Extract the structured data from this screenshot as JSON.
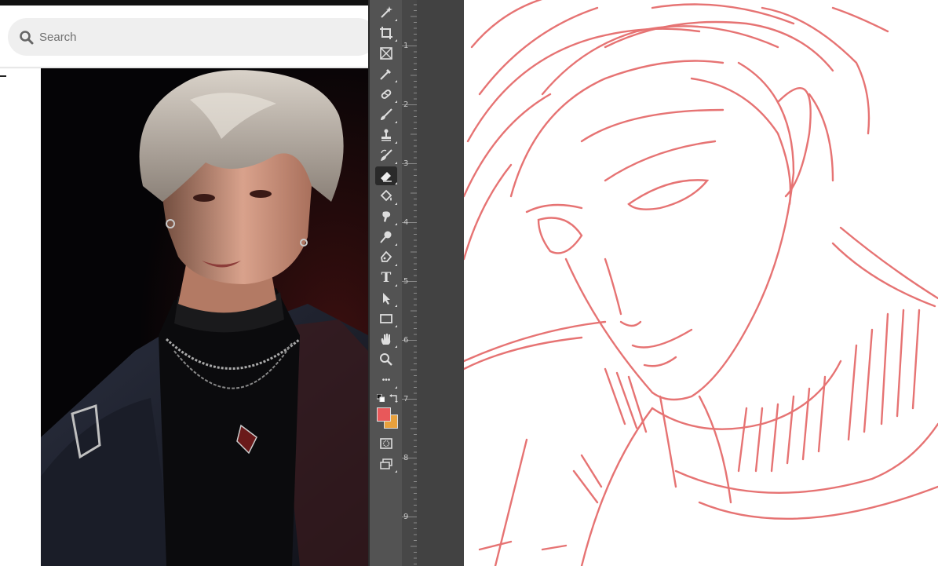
{
  "search": {
    "placeholder": "Search"
  },
  "reference_image": {
    "subject": "portrait-photo",
    "alt": ""
  },
  "toolbar": {
    "tools": [
      "magic-wand-icon",
      "crop-icon",
      "frame-icon",
      "eyedropper-icon",
      "healing-brush-icon",
      "brush-icon",
      "clone-stamp-icon",
      "history-brush-icon",
      "eraser-icon",
      "paint-bucket-icon",
      "smudge-icon",
      "dodge-icon",
      "pen-icon",
      "type-icon",
      "path-selection-icon",
      "rectangle-icon",
      "hand-icon",
      "zoom-icon",
      "more-tools-icon"
    ],
    "active_tool": "eraser-icon",
    "type_glyph": "T",
    "more_glyph": "•••",
    "foreground_color": "#e8585a",
    "background_color": "#e9a13c"
  },
  "ruler": {
    "labels": [
      "1",
      "2",
      "3",
      "4",
      "5",
      "6",
      "7",
      "8",
      "9"
    ]
  },
  "canvas": {
    "stroke_color": "#e25b5b",
    "subject": "line-sketch"
  }
}
